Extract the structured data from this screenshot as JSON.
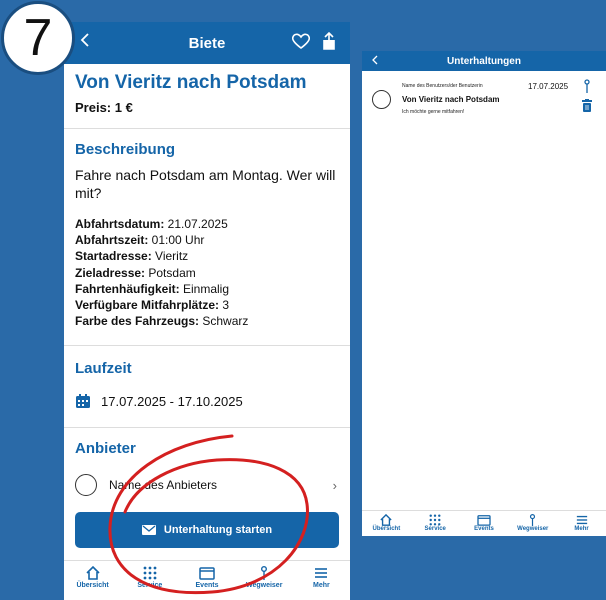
{
  "step_number": "7",
  "left_screen": {
    "header_title": "Biete",
    "offer_title": "Von Vieritz nach Potsdam",
    "price": "Preis: 1 €",
    "description_heading": "Beschreibung",
    "description": "Fahre nach Potsdam am Montag. Wer will mit?",
    "details": [
      {
        "label": "Abfahrtsdatum:",
        "value": " 21.07.2025"
      },
      {
        "label": "Abfahrtszeit:",
        "value": " 01:00 Uhr"
      },
      {
        "label": "Startadresse:",
        "value": " Vieritz"
      },
      {
        "label": "Zieladresse:",
        "value": " Potsdam"
      },
      {
        "label": "Fahrtenhäufigkeit:",
        "value": " Einmalig"
      },
      {
        "label": "Verfügbare Mitfahrplätze:",
        "value": " 3"
      },
      {
        "label": "Farbe des Fahrzeugs:",
        "value": " Schwarz"
      }
    ],
    "runtime_heading": "Laufzeit",
    "runtime_value": "17.07.2025 - 17.10.2025",
    "provider_heading": "Anbieter",
    "provider_name": "Name des Anbieters",
    "cta_label": "Unterhaltung starten",
    "tabs": [
      "Übersicht",
      "Service",
      "Events",
      "Wegweiser",
      "Mehr"
    ]
  },
  "right_screen": {
    "header_title": "Unterhaltungen",
    "conversation": {
      "user_name": "Name des Benutzers/der Benutzerin",
      "date": "17.07.2025",
      "title": "Von Vieritz nach Potsdam",
      "message": "Ich möchte gerne mitfahren!"
    },
    "tabs": [
      "Übersicht",
      "Service",
      "Events",
      "Wegweiser",
      "Mehr"
    ]
  },
  "colors": {
    "brand": "#1565a8",
    "background": "#2a6aa8",
    "annotation": "#d42020"
  }
}
